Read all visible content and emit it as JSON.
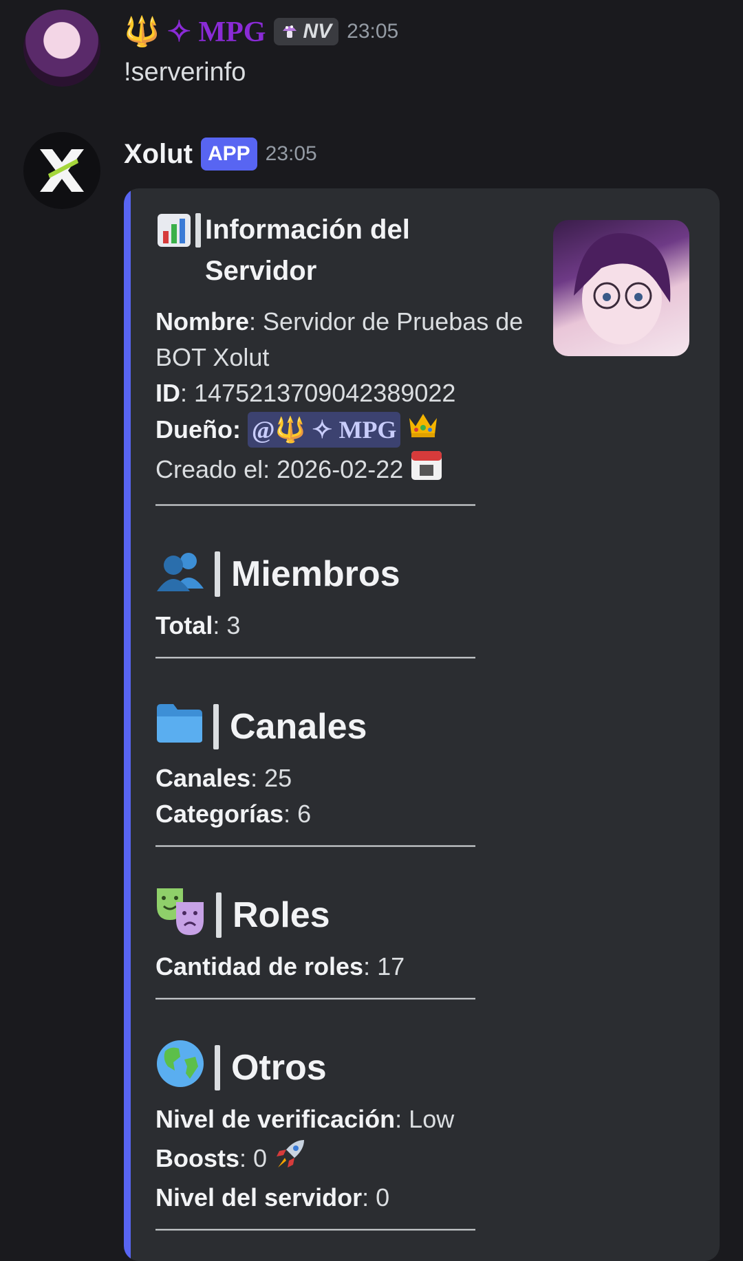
{
  "user_message": {
    "username": "🔱 ✧ MPG",
    "badge_label": "NV",
    "time": "23:05",
    "text": "!serverinfo"
  },
  "bot_message": {
    "name": "Xolut",
    "badge": "APP",
    "time": "23:05"
  },
  "embed": {
    "accent_color": "#5865f2",
    "title": "Información del Servidor",
    "fields": {
      "nombre_label": "Nombre",
      "nombre_value": "Servidor de Pruebas de BOT Xolut",
      "id_label": "ID",
      "id_value": "1475213709042389022",
      "owner_label": "Dueño:",
      "owner_mention": "@🔱 ✧ MPG",
      "created_label": "Creado el:",
      "created_value": "2026-02-22"
    },
    "separator": "————————————————",
    "members": {
      "heading": "Miembros",
      "total_label": "Total",
      "total_value": "3"
    },
    "channels": {
      "heading": "Canales",
      "canales_label": "Canales",
      "canales_value": "25",
      "categorias_label": "Categorías",
      "categorias_value": "6"
    },
    "roles": {
      "heading": "Roles",
      "count_label": "Cantidad de roles",
      "count_value": "17"
    },
    "others": {
      "heading": "Otros",
      "verification_label": "Nivel de verificación",
      "verification_value": "Low",
      "boosts_label": "Boosts",
      "boosts_value": "0",
      "server_level_label": "Nivel del servidor",
      "server_level_value": "0"
    }
  }
}
